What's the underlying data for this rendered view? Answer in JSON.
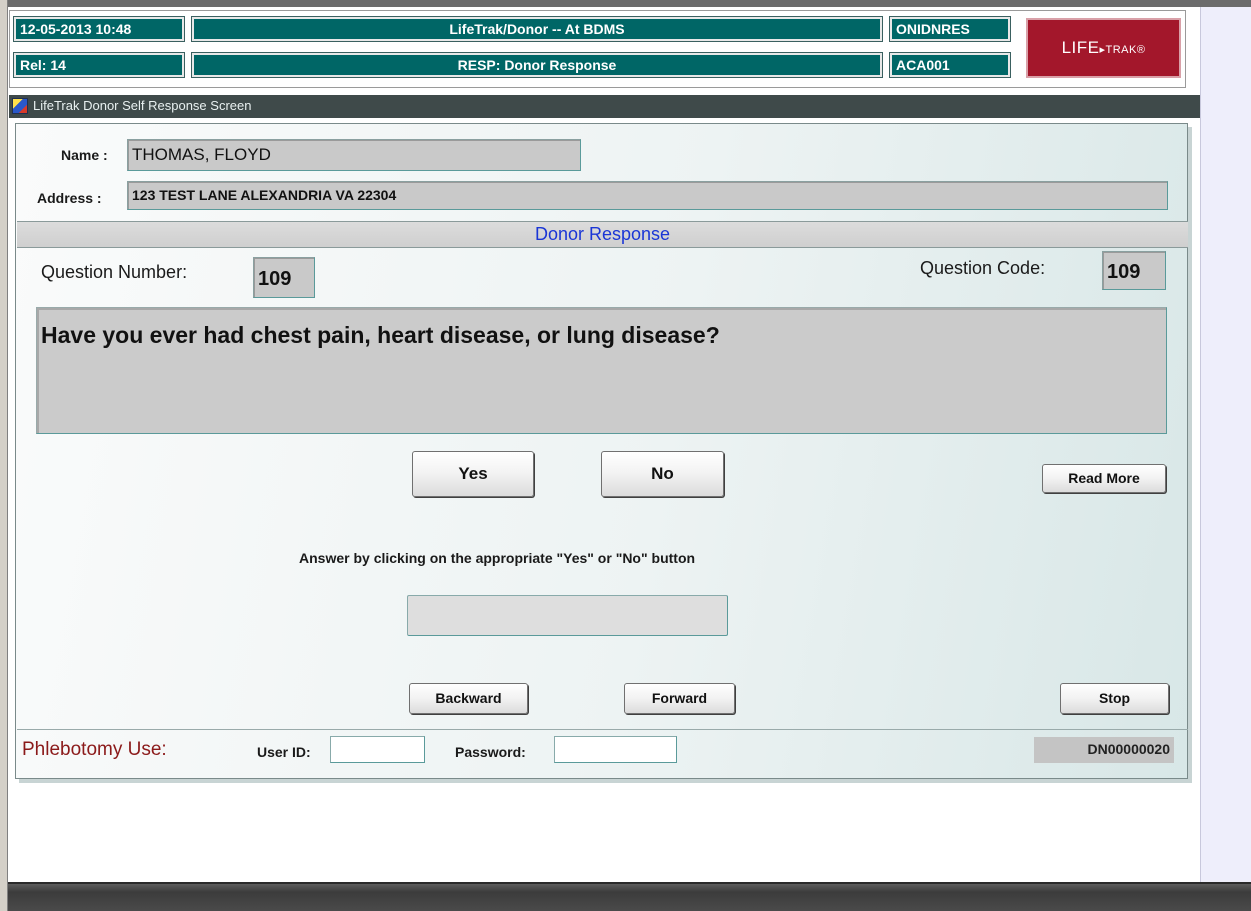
{
  "header": {
    "datetime": "12-05-2013  10:48",
    "release": "Rel: 14",
    "app_title": "LifeTrak/Donor -- At BDMS",
    "screen_title": "RESP: Donor Response",
    "screen_code": "ONIDNRES",
    "user_code": "ACA001",
    "logo_main": "LIFE",
    "logo_suffix": "▸TRAK®"
  },
  "window": {
    "title": "LifeTrak Donor Self Response Screen",
    "icon": "app-icon"
  },
  "donor": {
    "name_label": "Name :",
    "name_value": "THOMAS, FLOYD",
    "address_label": "Address :",
    "address_value": "123 TEST LANE  ALEXANDRIA VA 22304"
  },
  "section": {
    "title": "Donor Response"
  },
  "question": {
    "number_label": "Question Number:",
    "number_value": "109",
    "code_label": "Question Code:",
    "code_value": "109",
    "text": "Have you ever had chest pain, heart disease, or lung disease?"
  },
  "buttons": {
    "yes": "Yes",
    "no": "No",
    "read_more": "Read More",
    "backward": "Backward",
    "forward": "Forward",
    "stop": "Stop"
  },
  "instructions": "Answer by clicking on the appropriate \"Yes\"  or  \"No\" button",
  "answer_value": "",
  "footer": {
    "phlebotomy_label": "Phlebotomy Use:",
    "user_id_label": "User ID:",
    "user_id_value": "",
    "password_label": "Password:",
    "password_value": "",
    "record_code": "DN00000020"
  },
  "colors": {
    "header_teal": "#006666",
    "logo_red": "#a3172b",
    "section_title_blue": "#1a36d6",
    "phlebotomy_red": "#8b1a1a"
  }
}
